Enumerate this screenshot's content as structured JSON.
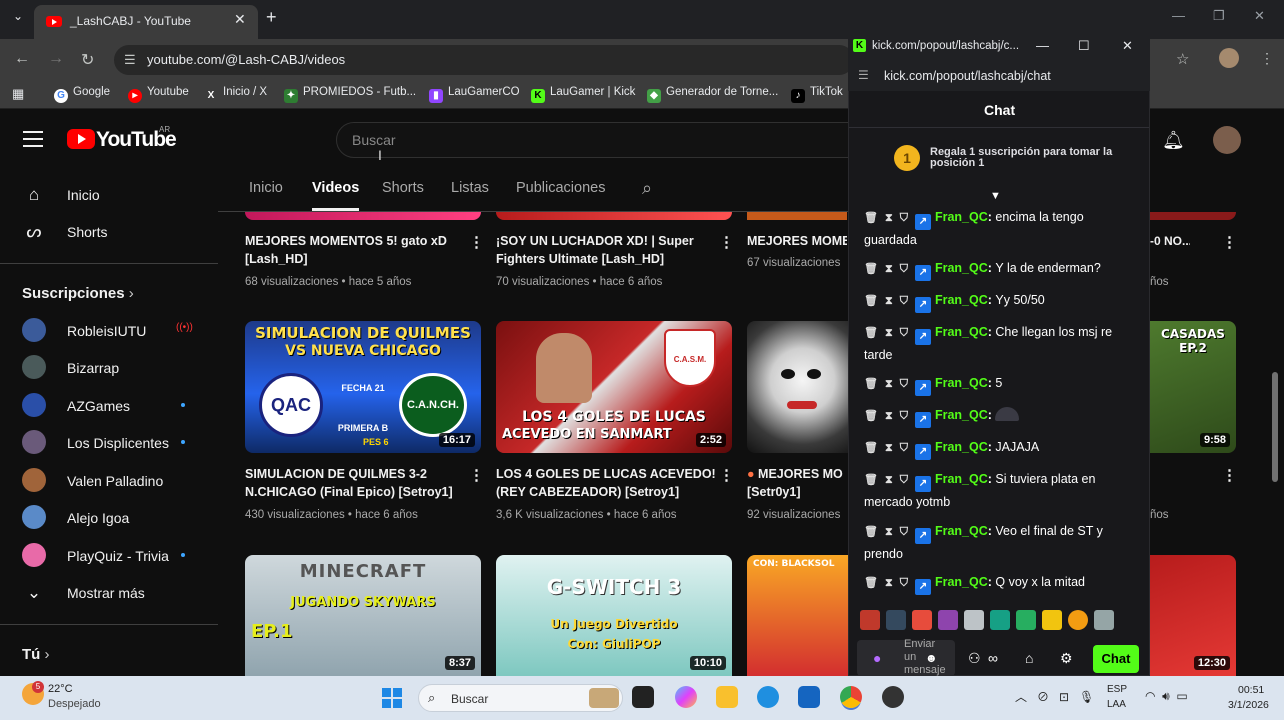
{
  "browser": {
    "tab_title": "_LashCABJ - YouTube",
    "tab_close": "✕",
    "new_tab": "+",
    "url": "youtube.com/@Lash-CABJ/videos",
    "bookmarks": [
      "Google",
      "Youtube",
      "Inicio / X",
      "PROMIEDOS - Futb...",
      "LauGamerCO",
      "LauGamer | Kick",
      "Generador de Torne...",
      "TikTok"
    ]
  },
  "youtube": {
    "logo_text": "YouTube",
    "country_code": "AR",
    "search_placeholder": "Buscar",
    "sidebar": {
      "home": "Inicio",
      "shorts": "Shorts",
      "subscriptions_header": "Suscripciones",
      "subscriptions": [
        {
          "name": "RobleisIUTU",
          "live": true
        },
        {
          "name": "Bizarrap",
          "live": false
        },
        {
          "name": "AZGames",
          "new": true
        },
        {
          "name": "Los Displicentes",
          "new": true
        },
        {
          "name": "Valen Palladino",
          "new": false
        },
        {
          "name": "Alejo Igoa",
          "new": false
        },
        {
          "name": "PlayQuiz - Trivia",
          "new": true
        }
      ],
      "show_more": "Mostrar más",
      "you": "Tú"
    },
    "channel_tabs": [
      "Inicio",
      "Videos",
      "Shorts",
      "Listas",
      "Publicaciones"
    ],
    "active_tab": "Videos",
    "videos_row1": [
      {
        "title": "MEJORES MOMENTOS 5! gato xD [Lash_HD]",
        "views": "68 visualizaciones",
        "age": "hace 5 años"
      },
      {
        "title": "¡SOY UN LUCHADOR XD! | Super Fighters Ultimate [Lash_HD]",
        "views": "70 visualizaciones",
        "age": "hace 6 años"
      },
      {
        "title": "MEJORES MOME",
        "views": "67 visualizaciones",
        "age": ""
      },
      {
        "title": "-0 NO...",
        "views": "",
        "age": "ños"
      }
    ],
    "videos_row2": [
      {
        "title": "SIMULACION DE QUILMES 3-2 N.CHICAGO (Final Epico) [Setroy1]",
        "views": "430 visualizaciones",
        "age": "hace 6 años",
        "duration": "16:17",
        "thumb_line1": "SIMULACION DE QUILMES",
        "thumb_line2": "VS NUEVA CHICAGO",
        "thumb_left": "QAC",
        "thumb_right": "C.A.N.CH.",
        "thumb_center": "FECHA 21",
        "thumb_sub": "PRIMERA B",
        "thumb_pes": "PES 6"
      },
      {
        "title": "LOS 4 GOLES DE LUCAS ACEVEDO! (REY CABEZEADOR) [Setroy1]",
        "views": "3,6 K visualizaciones",
        "age": "hace 6 años",
        "duration": "2:52",
        "thumb_line1": "LOS 4 GOLES DE LUCAS",
        "thumb_line2": "ACEVEDO EN SANMART",
        "thumb_badge": "C.A.S.M."
      },
      {
        "title": "MEJORES MO [Setr0y1]",
        "views": "92 visualizaciones",
        "age": "hace 6 años",
        "duration": ""
      },
      {
        "title": "",
        "views": "",
        "age": "ños",
        "duration": "9:58",
        "thumb_text": "CASADAS EP.2"
      }
    ],
    "videos_row3": [
      {
        "duration": "8:37",
        "thumb_line1": "MINECRAFT",
        "thumb_line2": "JUGANDO SKYWARS",
        "thumb_line3": "EP.1"
      },
      {
        "duration": "10:10",
        "thumb_line1": "G-SWITCH 3",
        "thumb_line2": "Un Juego Divertido",
        "thumb_line3": "Con: GiuliPOP"
      },
      {
        "duration": "",
        "thumb_line1": "CON: BLACKSOL"
      },
      {
        "duration": "12:30"
      }
    ]
  },
  "kick": {
    "window_title": "kick.com/popout/lashcabj/c...",
    "url": "kick.com/popout/lashcabj/chat",
    "header": "Chat",
    "gift_number": "1",
    "gift_text": "Regala 1 suscripción para tomar la posición 1",
    "messages": [
      {
        "user": "Fran_QC",
        "text": "encima la tengo guardada"
      },
      {
        "user": "Fran_QC",
        "text": "Y la de enderman?"
      },
      {
        "user": "Fran_QC",
        "text": "Yy 50/50"
      },
      {
        "user": "Fran_QC",
        "text": "Che llegan los msj re tarde"
      },
      {
        "user": "Fran_QC",
        "text": "5"
      },
      {
        "user": "Fran_QC",
        "text": ""
      },
      {
        "user": "Fran_QC",
        "text": "JAJAJA"
      },
      {
        "user": "Fran_QC",
        "text": "Si tuviera plata en mercado yotmb"
      },
      {
        "user": "Fran_QC",
        "text": "Veo el final de ST y prendo"
      },
      {
        "user": "Fran_QC",
        "text": "Q voy x la mitad"
      }
    ],
    "input_placeholder": "Enviar un mensaje",
    "send_button": "Chat"
  },
  "taskbar": {
    "weather_badge": "5",
    "temperature": "22°C",
    "weather": "Despejado",
    "search": "Buscar",
    "lang1": "ESP",
    "lang2": "LAA",
    "time": "00:51",
    "date": "3/1/2026"
  },
  "colors": {
    "yt_red": "#ff0000",
    "kick_green": "#53fc18",
    "bg": "#0f0f0f"
  }
}
